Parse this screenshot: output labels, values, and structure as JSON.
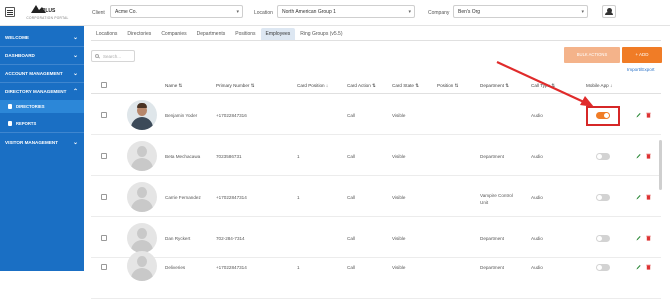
{
  "header": {
    "logo_subtitle": "CORPORATION PORTAL",
    "client_label": "Client",
    "client_value": "Acme Co.",
    "location_label": "Location",
    "location_value": "North American Group 1",
    "company_label": "Company",
    "company_value": "Ben's Org"
  },
  "sidebar": {
    "items": [
      {
        "label": "WELCOME"
      },
      {
        "label": "DASHBOARD"
      },
      {
        "label": "ACCOUNT MANAGEMENT"
      },
      {
        "label": "DIRECTORY MANAGEMENT"
      },
      {
        "label": "VISITOR MANAGEMENT"
      }
    ],
    "sub_items": [
      {
        "label": "DIRECTORIES"
      },
      {
        "label": "REPORTS"
      }
    ]
  },
  "tabs": [
    "Locations",
    "Directories",
    "Companies",
    "Departments",
    "Positions",
    "Employees",
    "Ring Groups (v5.5)"
  ],
  "search": {
    "placeholder": "Search..."
  },
  "actions": {
    "bulk": "BULK ACTIONS",
    "add": "+ ADD",
    "import_export": "Import/Export"
  },
  "table": {
    "columns": [
      "Name",
      "Primary Number",
      "Card Position",
      "Card Action",
      "Card State",
      "Position",
      "Department",
      "Call Type",
      "Mobile App"
    ],
    "rows": [
      {
        "name": "Benjamin Yoder",
        "primary": "+17022847316",
        "card_position": "",
        "card_action": "Call",
        "card_state": "Visible",
        "position": "",
        "department": "",
        "call_type": "Audio",
        "mobile_app": true
      },
      {
        "name": "Beta Mechacawa",
        "primary": "7023586731",
        "card_position": "1",
        "card_action": "Call",
        "card_state": "Visible",
        "position": "",
        "department": "Department",
        "call_type": "Audio",
        "mobile_app": false
      },
      {
        "name": "Carrie Fernandez",
        "primary": "+17022847314",
        "card_position": "1",
        "card_action": "Call",
        "card_state": "Visible",
        "position": "",
        "department": "Vampire Control Unit",
        "call_type": "Audio",
        "mobile_app": false
      },
      {
        "name": "Dan Ryckert",
        "primary": "702-284-7314",
        "card_position": "",
        "card_action": "Call",
        "card_state": "Visible",
        "position": "",
        "department": "Department",
        "call_type": "Audio",
        "mobile_app": false
      },
      {
        "name": "Deliveries",
        "primary": "+17022847314",
        "card_position": "1",
        "card_action": "Call",
        "card_state": "Visible",
        "position": "",
        "department": "Department",
        "call_type": "Audio",
        "mobile_app": false
      }
    ]
  },
  "colors": {
    "sidebar": "#1a6fc4",
    "accent": "#f07c26",
    "highlight": "#d62727"
  }
}
